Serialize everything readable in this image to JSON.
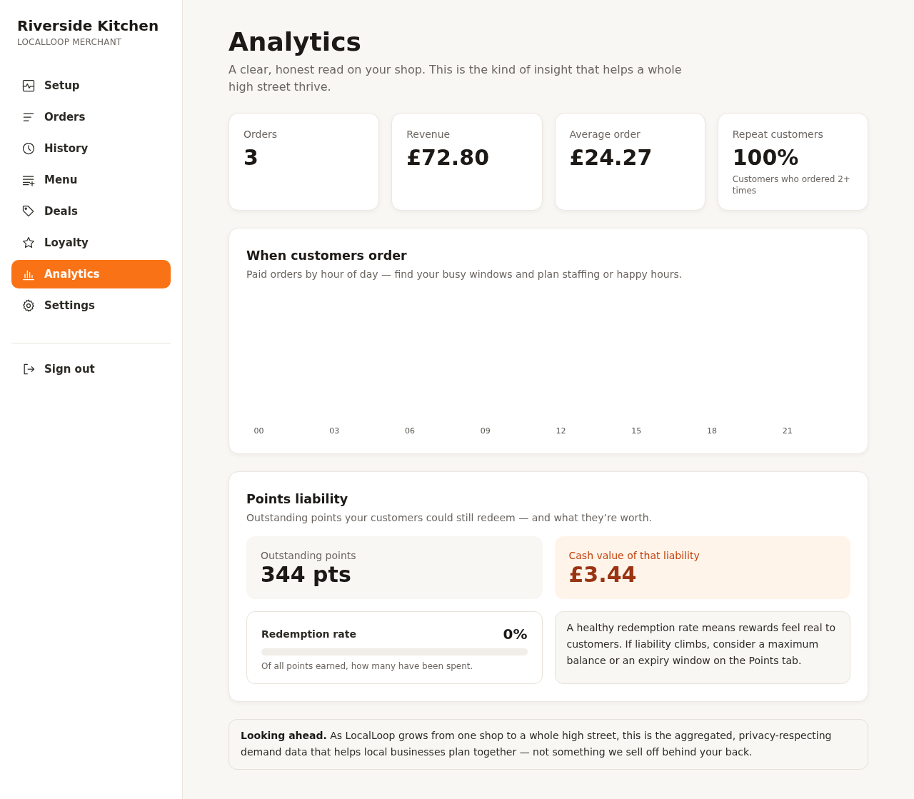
{
  "sidebar": {
    "brand": "Riverside Kitchen",
    "subtitle": "LOCALLOOP MERCHANT",
    "items": [
      {
        "label": "Setup",
        "selected": false
      },
      {
        "label": "Orders",
        "selected": false
      },
      {
        "label": "History",
        "selected": false
      },
      {
        "label": "Menu",
        "selected": false
      },
      {
        "label": "Deals",
        "selected": false
      },
      {
        "label": "Loyalty",
        "selected": false
      },
      {
        "label": "Analytics",
        "selected": true
      },
      {
        "label": "Settings",
        "selected": false
      }
    ],
    "sign_out": "Sign out"
  },
  "header": {
    "title": "Analytics",
    "subtitle": "A clear, honest read on your shop. This is the kind of insight that helps a whole high street thrive."
  },
  "stats": [
    {
      "label": "Orders",
      "value": "3"
    },
    {
      "label": "Revenue",
      "value": "£72.80"
    },
    {
      "label": "Average order",
      "value": "£24.27"
    },
    {
      "label": "Repeat customers",
      "value": "100%",
      "note": "Customers who ordered 2+ times"
    }
  ],
  "hourly_chart": {
    "title": "When customers order",
    "subtitle": "Paid orders by hour of day — find your busy windows and plan staffing or happy hours.",
    "hour_labels": [
      "00",
      "03",
      "06",
      "09",
      "12",
      "15",
      "18",
      "21"
    ]
  },
  "points_liability": {
    "title": "Points liability",
    "subtitle": "Outstanding points your customers could still redeem — and what they’re worth.",
    "tiles": [
      {
        "kind": "neutral",
        "label": "Outstanding points",
        "value": "344 pts"
      },
      {
        "kind": "highlight",
        "label": "Cash value of that liability",
        "value": "£3.44"
      }
    ],
    "redemption": {
      "label": "Redemption rate",
      "reading": "0%",
      "caption": "Of all points earned, how many have been spent."
    },
    "advice": "A healthy redemption rate means rewards feel real to customers. If liability climbs, consider a maximum balance or an expiry window on the Points tab."
  },
  "footer_note": "**Looking ahead.** As LocalLoop grows from one shop to a whole high street, this is the aggregated, privacy-respecting demand data that helps local businesses plan together — not something we sell off behind your back."
}
